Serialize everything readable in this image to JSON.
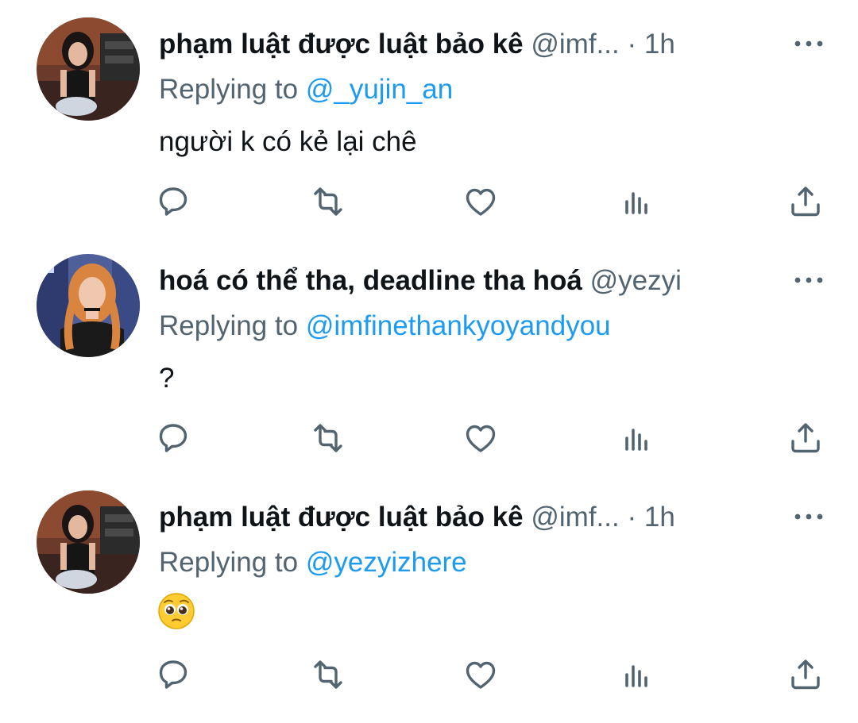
{
  "colors": {
    "text": "#0f1419",
    "secondary": "#536471",
    "accent": "#1d9bf0"
  },
  "tweets": [
    {
      "name": "phạm luật được luật bảo kê",
      "handle": "@imf...",
      "separator": "·",
      "time": "1h",
      "replying_prefix": "Replying to ",
      "replying_to": "@_yujin_an",
      "text": "người k có kẻ lại chê",
      "avatar": "avatar-photo-woman-dark-hair"
    },
    {
      "name": "hoá có thể tha, deadline tha hoá",
      "handle": "@yezyi",
      "separator": "",
      "time": "",
      "replying_prefix": "Replying to ",
      "replying_to": "@imfinethankyoyandyou",
      "text": "?",
      "avatar": "avatar-photo-woman-orange-hair"
    },
    {
      "name": "phạm luật được luật bảo kê",
      "handle": "@imf...",
      "separator": "·",
      "time": "1h",
      "replying_prefix": "Replying to ",
      "replying_to": "@yezyizhere",
      "text": "",
      "emoji": "pleading-face-emoji",
      "avatar": "avatar-photo-woman-dark-hair"
    }
  ],
  "action_icons": [
    "reply-icon",
    "retweet-icon",
    "like-icon",
    "views-icon",
    "share-icon"
  ]
}
